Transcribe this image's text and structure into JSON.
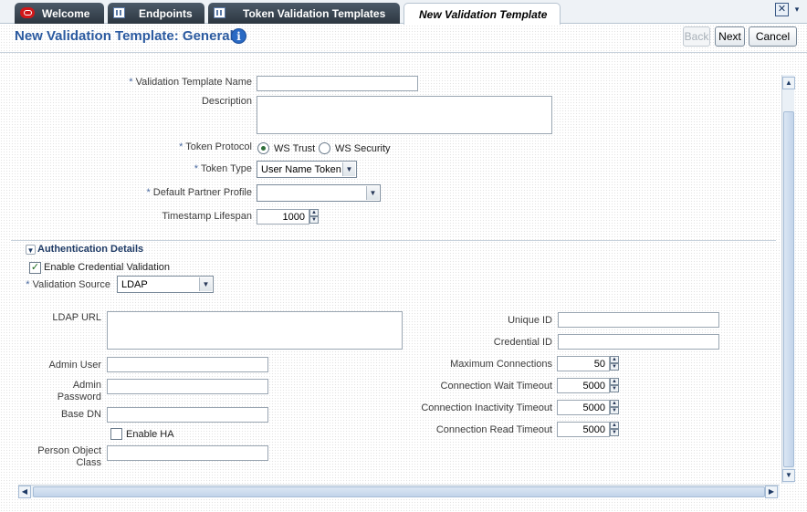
{
  "tabs": [
    {
      "label": "Welcome",
      "icon": "oracle-logo-icon"
    },
    {
      "label": "Endpoints",
      "icon": "table-icon"
    },
    {
      "label": "Token Validation Templates",
      "icon": "table-icon"
    },
    {
      "label": "New Validation Template",
      "icon": ""
    }
  ],
  "header": {
    "title": "New Validation Template: General",
    "back_label": "Back",
    "next_label": "Next",
    "cancel_label": "Cancel"
  },
  "general": {
    "template_name_label": "Validation Template Name",
    "template_name_value": "",
    "description_label": "Description",
    "description_value": "",
    "token_protocol_label": "Token Protocol",
    "token_protocol_options": [
      "WS Trust",
      "WS Security"
    ],
    "token_protocol_selected": "WS Trust",
    "token_type_label": "Token Type",
    "token_type_value": "User Name Token",
    "partner_profile_label": "Default Partner Profile",
    "partner_profile_value": "",
    "timestamp_label": "Timestamp Lifespan",
    "timestamp_value": "1000"
  },
  "auth": {
    "section_title": "Authentication Details",
    "enable_validation_label": "Enable Credential Validation",
    "enable_validation_checked": true,
    "validation_source_label": "Validation Source",
    "validation_source_value": "LDAP",
    "ldap_url_label": "LDAP URL",
    "admin_user_label": "Admin User",
    "admin_password_label_1": "Admin",
    "admin_password_label_2": "Password",
    "base_dn_label": "Base DN",
    "enable_ha_label": "Enable HA",
    "enable_ha_checked": false,
    "person_class_label_1": "Person Object",
    "person_class_label_2": "Class",
    "unique_id_label": "Unique ID",
    "credential_id_label": "Credential ID",
    "max_connections_label": "Maximum Connections",
    "max_connections_value": "50",
    "wait_timeout_label": "Connection Wait Timeout",
    "wait_timeout_value": "5000",
    "inactivity_timeout_label": "Connection Inactivity Timeout",
    "inactivity_timeout_value": "5000",
    "read_timeout_label": "Connection Read Timeout",
    "read_timeout_value": "5000"
  },
  "colors": {
    "title": "#2b5aa0",
    "tab_dark": "#2c3640",
    "accent": "#2a6ac4"
  }
}
